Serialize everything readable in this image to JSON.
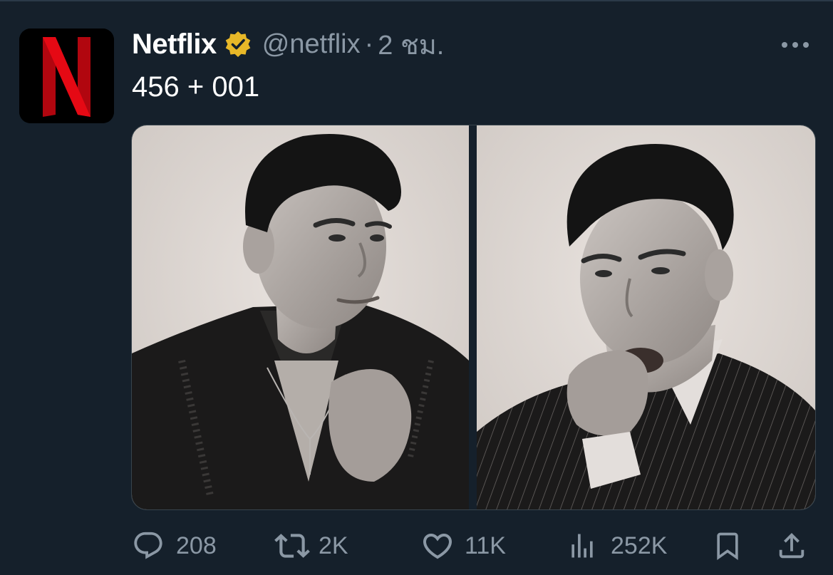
{
  "account": {
    "name": "Netflix",
    "handle": "@netflix",
    "separator": "·",
    "time": "2 ชม.",
    "avatar_letter": "N",
    "avatar_letter_color": "#e50914",
    "verified_color": "#e8b828"
  },
  "tweet": {
    "text": "456 + 001"
  },
  "media": {
    "photos": [
      {
        "icon": "man-portrait-photo",
        "description_hidden": true
      },
      {
        "icon": "man-portrait-photo",
        "description_hidden": true
      }
    ]
  },
  "actions": {
    "reply": {
      "icon": "reply-icon",
      "count": "208"
    },
    "retweet": {
      "icon": "retweet-icon",
      "count": "2K"
    },
    "like": {
      "icon": "heart-icon",
      "count": "11K"
    },
    "views": {
      "icon": "views-chart-icon",
      "count": "252K"
    },
    "bookmark": {
      "icon": "bookmark-icon"
    },
    "share": {
      "icon": "share-icon"
    }
  },
  "colors": {
    "background": "#15202b",
    "text_primary": "#ffffff",
    "text_secondary": "#8b98a5"
  }
}
